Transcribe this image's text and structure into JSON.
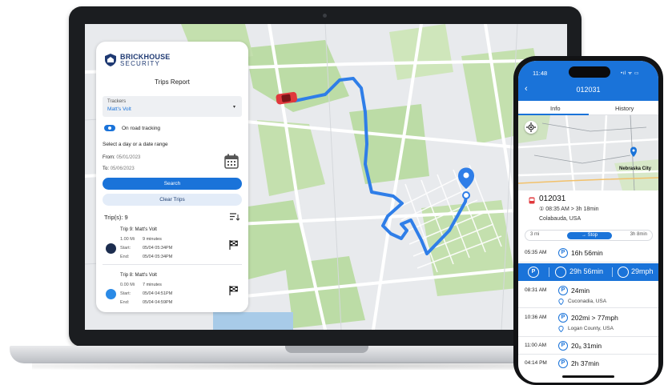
{
  "laptop": {
    "brand": {
      "name": "BRICKHOUSE",
      "sub": "SECURITY"
    },
    "title": "Trips Report",
    "tracker": {
      "label": "Trackers",
      "value": "Matt's Volt"
    },
    "on_road_label": "On road tracking",
    "date_prompt": "Select a day or a date range",
    "from_label": "From:",
    "from_value": "05/01/2023",
    "to_label": "To:",
    "to_value": "05/06/2023",
    "search_label": "Search",
    "clear_label": "Clear Trips",
    "trips_count": "Trip(s): 9",
    "trips": [
      {
        "title": "Trip 9: Matt's Volt",
        "distance": "1.00 Mi",
        "duration": "9 minutes",
        "start_label": "Start:",
        "start": "05/04 05:34PM",
        "end_label": "End:",
        "end": "05/04 05:34PM",
        "dot_color": "#1c2d4f"
      },
      {
        "title": "Trip 8: Matt's Volt",
        "distance": "0.00 Mi",
        "duration": "7 minutes",
        "start_label": "Start:",
        "start": "05/04 04:51PM",
        "end_label": "End:",
        "end": "05/04 04:59PM",
        "dot_color": "#2a8ae6"
      }
    ]
  },
  "phone": {
    "time": "11:48",
    "status": "•ıl ᯤ ▭",
    "header_title": "012031",
    "back_glyph": "‹",
    "tabs": [
      {
        "label": "Info"
      },
      {
        "label": "History"
      }
    ],
    "map_city": "Nebraska City",
    "trip": {
      "id": "012031",
      "meta": "① 08:35 AM  >  3h 18min",
      "location": "Colabauda, USA"
    },
    "progress": {
      "left": "3 mi",
      "pill": "→ Stop",
      "right": "3h 8min"
    },
    "rows": [
      {
        "time": "05:35 AM",
        "value": "16h 56min"
      },
      {
        "time": "08:31 AM",
        "value": "24min",
        "sub": "Cuconadia, USA"
      },
      {
        "time": "10:36 AM",
        "value": "202mi  >  77mph",
        "sub": "Logan County, USA"
      },
      {
        "time": "11:00 AM",
        "value": "20ₐ 31min"
      },
      {
        "time": "04:14 PM",
        "value": "2h 37min"
      }
    ],
    "highlight": {
      "duration": "29h 56min",
      "speed": "29mph"
    },
    "p_glyph": "P"
  },
  "colors": {
    "accent": "#1a73d9",
    "route": "#2f7ee8",
    "car": "#e0383c",
    "map_base": "#e8eaed",
    "park": "#b9d9a4"
  }
}
